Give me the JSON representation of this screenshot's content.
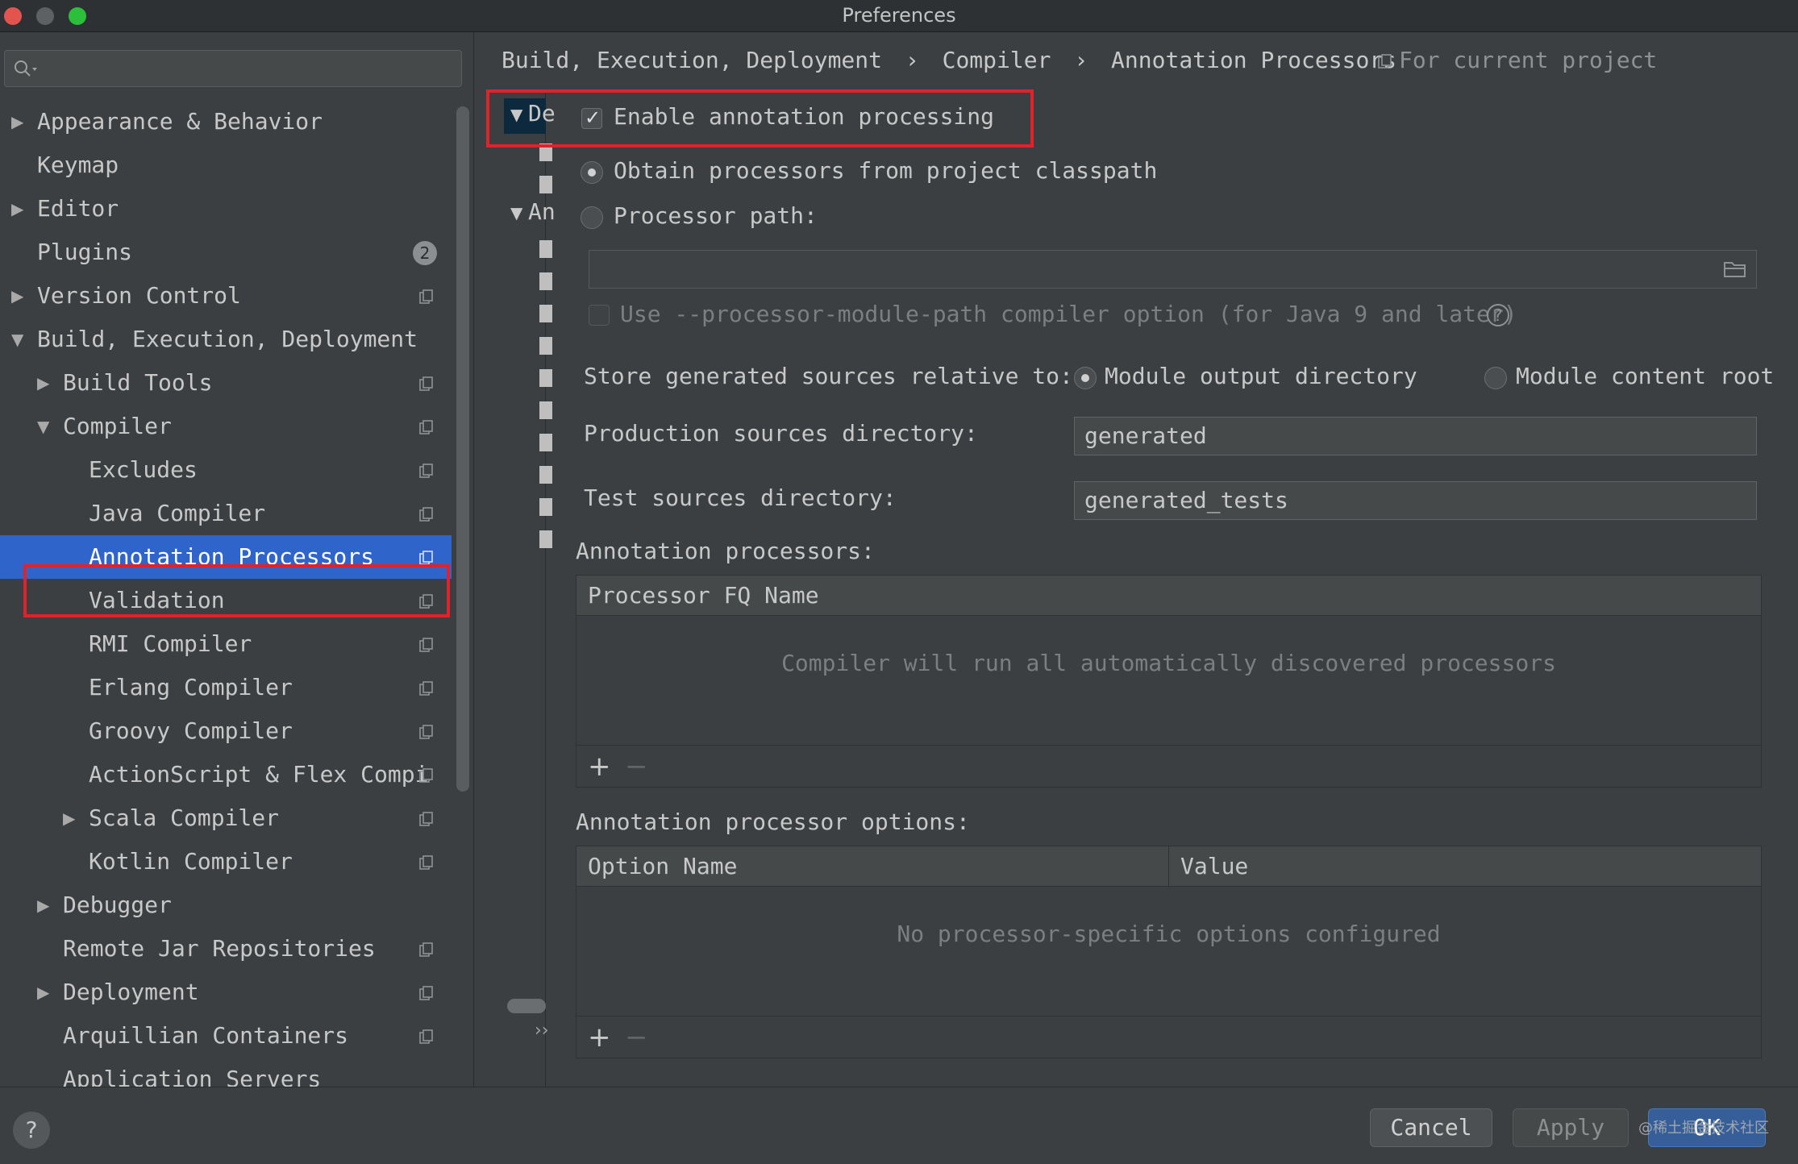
{
  "window": {
    "title": "Preferences"
  },
  "search": {
    "placeholder": ""
  },
  "tree": [
    {
      "label": "Appearance & Behavior",
      "arrow": "▶",
      "indent": 0
    },
    {
      "label": "Keymap",
      "arrow": "",
      "indent": 0
    },
    {
      "label": "Editor",
      "arrow": "▶",
      "indent": 0
    },
    {
      "label": "Plugins",
      "arrow": "",
      "indent": 0,
      "badge": "2"
    },
    {
      "label": "Version Control",
      "arrow": "▶",
      "indent": 0,
      "copy": true
    },
    {
      "label": "Build, Execution, Deployment",
      "arrow": "▼",
      "indent": 0
    },
    {
      "label": "Build Tools",
      "arrow": "▶",
      "indent": 1,
      "copy": true
    },
    {
      "label": "Compiler",
      "arrow": "▼",
      "indent": 1,
      "copy": true
    },
    {
      "label": "Excludes",
      "arrow": "",
      "indent": 2,
      "copy": true
    },
    {
      "label": "Java Compiler",
      "arrow": "",
      "indent": 2,
      "copy": true
    },
    {
      "label": "Annotation Processors",
      "arrow": "",
      "indent": 2,
      "copy": true,
      "selected": true
    },
    {
      "label": "Validation",
      "arrow": "",
      "indent": 2,
      "copy": true
    },
    {
      "label": "RMI Compiler",
      "arrow": "",
      "indent": 2,
      "copy": true
    },
    {
      "label": "Erlang Compiler",
      "arrow": "",
      "indent": 2,
      "copy": true
    },
    {
      "label": "Groovy Compiler",
      "arrow": "",
      "indent": 2,
      "copy": true
    },
    {
      "label": "ActionScript & Flex Compi",
      "arrow": "",
      "indent": 2,
      "copy": true
    },
    {
      "label": "Scala Compiler",
      "arrow": "▶",
      "indent": 2,
      "copy": true
    },
    {
      "label": "Kotlin Compiler",
      "arrow": "",
      "indent": 2,
      "copy": true
    },
    {
      "label": "Debugger",
      "arrow": "▶",
      "indent": 1
    },
    {
      "label": "Remote Jar Repositories",
      "arrow": "",
      "indent": 1,
      "copy": true
    },
    {
      "label": "Deployment",
      "arrow": "▶",
      "indent": 1,
      "copy": true
    },
    {
      "label": "Arquillian Containers",
      "arrow": "",
      "indent": 1,
      "copy": true
    },
    {
      "label": "Application Servers",
      "arrow": "",
      "indent": 1
    }
  ],
  "breadcrumb": {
    "items": [
      "Build, Execution, Deployment",
      "Compiler",
      "Annotation Processors"
    ],
    "separator": "›",
    "scope": "For current project"
  },
  "profiles": {
    "default_label": "De",
    "annotation_label": "An"
  },
  "settings": {
    "enable_processing": "Enable annotation processing",
    "obtain_classpath": "Obtain processors from project classpath",
    "processor_path": "Processor path:",
    "processor_path_value": "",
    "module_path_option": "Use --processor-module-path compiler option (for Java 9 and later)",
    "store_relative": "Store generated sources relative to:",
    "module_output": "Module output directory",
    "module_content": "Module content root",
    "production_dir_label": "Production sources directory:",
    "production_dir_value": "generated",
    "test_dir_label": "Test sources directory:",
    "test_dir_value": "generated_tests"
  },
  "processors_table": {
    "title": "Annotation processors:",
    "column": "Processor FQ Name",
    "empty": "Compiler will run all automatically discovered processors"
  },
  "options_table": {
    "title": "Annotation processor options:",
    "columns": [
      "Option Name",
      "Value"
    ],
    "empty": "No processor-specific options configured"
  },
  "toolbar": {
    "add": "+",
    "remove": "−"
  },
  "footer": {
    "help": "?",
    "cancel": "Cancel",
    "apply": "Apply",
    "ok": "OK",
    "watermark": "@稀土掘金技术社区"
  },
  "colors": {
    "selection": "#2f65ca",
    "highlight": "#e0222b",
    "background": "#3c3f41"
  }
}
